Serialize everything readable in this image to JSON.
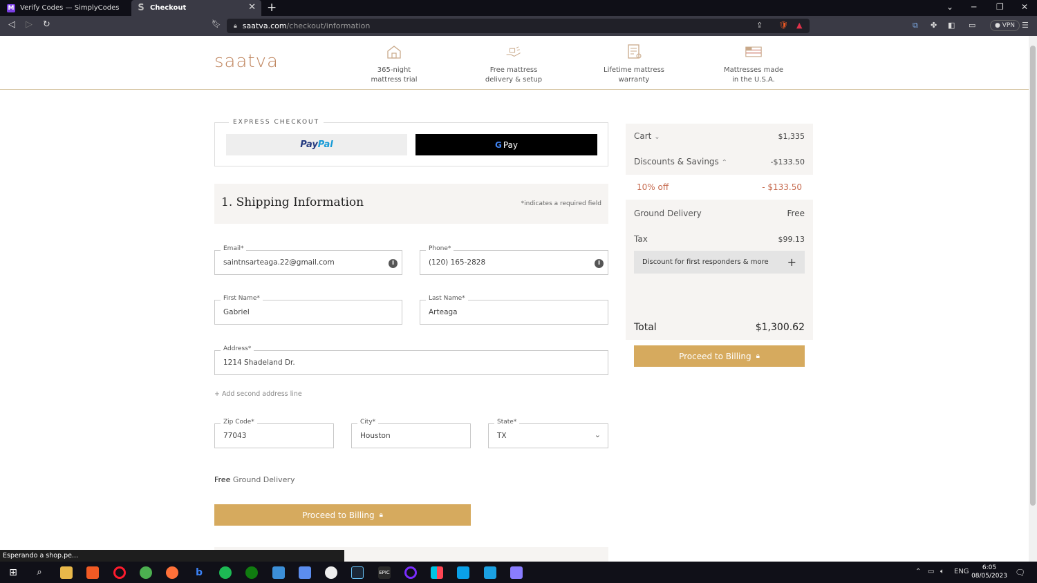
{
  "browser": {
    "tabs": [
      {
        "label": "Verify Codes — SimplyCodes",
        "icon": "simplycodes-icon",
        "active": false
      },
      {
        "label": "Checkout",
        "icon": "saatva-s-icon",
        "active": true
      }
    ],
    "url_host": "saatva.com",
    "url_path": "/checkout/information",
    "vpn_label": "VPN"
  },
  "header": {
    "logo": "saatva",
    "benefits": [
      {
        "line1": "365-night",
        "line2": "mattress trial"
      },
      {
        "line1": "Free mattress",
        "line2": "delivery & setup"
      },
      {
        "line1": "Lifetime mattress",
        "line2": "warranty"
      },
      {
        "line1": "Mattresses made",
        "line2": "in the U.S.A."
      }
    ]
  },
  "express": {
    "label": "EXPRESS CHECKOUT",
    "paypal_a": "Pay",
    "paypal_b": "Pal",
    "gpay_g": "G",
    "gpay_text": "Pay"
  },
  "shipping": {
    "title": "1. Shipping Information",
    "required_note": "*indicates a required field",
    "email_label": "Email*",
    "email_value": "saintnsarteaga.22@gmail.com",
    "phone_label": "Phone*",
    "phone_value": "(120) 165-2828",
    "first_label": "First Name*",
    "first_value": "Gabriel",
    "last_label": "Last Name*",
    "last_value": "Arteaga",
    "address_label": "Address*",
    "address_value": "1214 Shadeland Dr.",
    "add_line": "+ Add second address line",
    "zip_label": "Zip Code*",
    "zip_value": "77043",
    "city_label": "City*",
    "city_value": "Houston",
    "state_label": "State*",
    "state_value": "TX",
    "free_bold": "Free",
    "free_rest": " Ground Delivery",
    "proceed": "Proceed to Billing"
  },
  "summary": {
    "cart_label": "Cart",
    "cart_value": "$1,335",
    "discounts_label": "Discounts & Savings",
    "discounts_value": "-$133.50",
    "off_label": "10% off",
    "off_value": "- $133.50",
    "delivery_label": "Ground Delivery",
    "delivery_value": "Free",
    "tax_label": "Tax",
    "tax_value": "$99.13",
    "responders": "Discount for first responders & more",
    "total_label": "Total",
    "total_value": "$1,300.62",
    "proceed": "Proceed to Billing"
  },
  "status_text": "Esperando a shop.pe...",
  "taskbar": {
    "lang": "ENG",
    "time": "6:05",
    "date": "08/05/2023"
  }
}
